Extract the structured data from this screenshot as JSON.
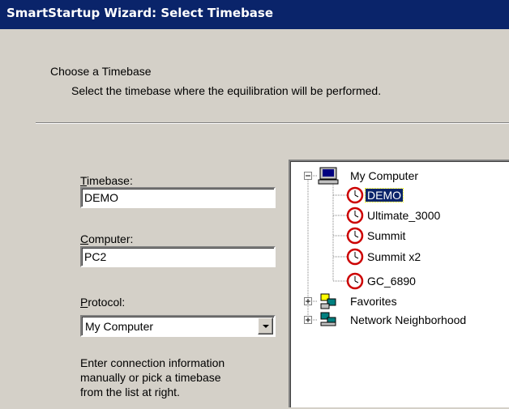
{
  "window": {
    "title": "SmartStartup Wizard: Select Timebase"
  },
  "header": {
    "title": "Choose a Timebase",
    "subtitle": "Select the timebase where the equilibration will be performed."
  },
  "form": {
    "timebase": {
      "label_acc": "T",
      "label_rest": "imebase:",
      "value": "DEMO"
    },
    "computer": {
      "label_acc": "C",
      "label_rest": "omputer:",
      "value": "PC2"
    },
    "protocol": {
      "label_acc": "P",
      "label_rest": "rotocol:",
      "value": "My Computer"
    },
    "hint": [
      "Enter connection information",
      "manually or pick a timebase",
      "from the list at right."
    ]
  },
  "tree": {
    "root": {
      "label": "My Computer",
      "icon": "computer-icon",
      "expander": "-"
    },
    "timebases": [
      {
        "label": "DEMO",
        "icon": "clock-icon",
        "selected": true
      },
      {
        "label": "Ultimate_3000",
        "icon": "clock-icon"
      },
      {
        "label": "Summit",
        "icon": "clock-icon"
      },
      {
        "label": "Summit x2",
        "icon": "clock-icon"
      },
      {
        "label": "GC_6890",
        "icon": "clock-icon"
      }
    ],
    "others": [
      {
        "label": "Favorites",
        "icon": "network-icon",
        "expander": "+"
      },
      {
        "label": "Network Neighborhood",
        "icon": "network-icon",
        "expander": "+"
      }
    ]
  },
  "colors": {
    "titlebar": "#0a246a",
    "dialog": "#d4d0c8",
    "clock": "#cc0000",
    "selection": "#0a246a"
  }
}
